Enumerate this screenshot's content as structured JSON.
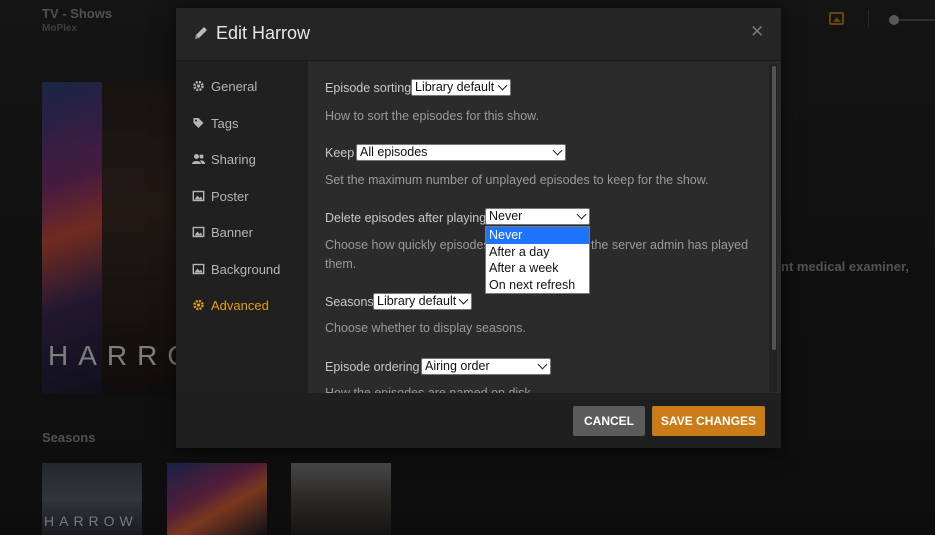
{
  "app": {
    "title": "TV - Shows",
    "subtitle": "MoPlex"
  },
  "background": {
    "poster_text": "HARROW",
    "description_fragment": "nt medical examiner,",
    "seasons_label": "Seasons",
    "season_thumb_text": "HARROW"
  },
  "modal": {
    "title": "Edit Harrow",
    "sidebar": [
      {
        "label": "General",
        "icon": "gear-icon"
      },
      {
        "label": "Tags",
        "icon": "tag-icon"
      },
      {
        "label": "Sharing",
        "icon": "users-icon"
      },
      {
        "label": "Poster",
        "icon": "image-icon"
      },
      {
        "label": "Banner",
        "icon": "image-icon"
      },
      {
        "label": "Background",
        "icon": "image-icon"
      },
      {
        "label": "Advanced",
        "icon": "gear-icon",
        "active": true
      }
    ],
    "fields": {
      "episode_sorting": {
        "label": "Episode sorting",
        "value": "Library default",
        "help": "How to sort the episodes for this show."
      },
      "keep": {
        "label": "Keep",
        "value": "All episodes",
        "help": "Set the maximum number of unplayed episodes to keep for the show."
      },
      "delete_after": {
        "label": "Delete episodes after playing",
        "value": "Never",
        "help_line1_a": "Choose how quickly episodes",
        "help_line1_b": "the server admin has played",
        "help_line2": "them.",
        "options": [
          "Never",
          "After a day",
          "After a week",
          "On next refresh"
        ]
      },
      "seasons": {
        "label": "Seasons",
        "value": "Library default",
        "help": "Choose whether to display seasons."
      },
      "episode_ordering": {
        "label": "Episode ordering",
        "value": "Airing order",
        "help": "How the episodes are named on disk."
      }
    },
    "buttons": {
      "cancel": "CANCEL",
      "save": "SAVE CHANGES"
    }
  },
  "colors": {
    "accent": "#e5a00d",
    "save": "#cc7b19",
    "cancel": "#5b5b5b",
    "selected_option": "#1e74ff"
  }
}
